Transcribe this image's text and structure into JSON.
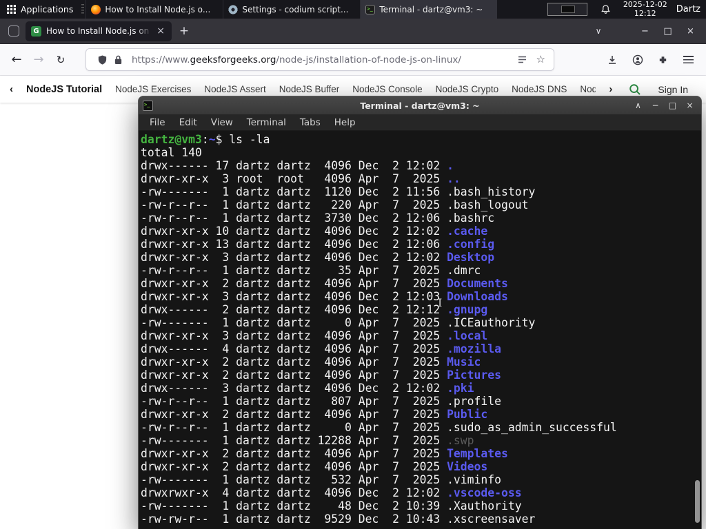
{
  "colors": {
    "panel_bg": "#17171c",
    "tab_bg": "#1d1c23",
    "toolbar_bg": "#f9f9fb",
    "gfg_green": "#2f8d46",
    "terminal_bg": "#151515",
    "terminal_text": "#f2f2f2",
    "terminal_dir_blue": "#5a5aef",
    "terminal_prompt_green": "#44b340",
    "terminal_dim_gray": "#5a5a5a"
  },
  "panel": {
    "applications_label": "Applications",
    "tasks": [
      {
        "label": "How to Install Node.js o...",
        "icon": "firefox"
      },
      {
        "label": "Settings - codium script...",
        "icon": "settings"
      },
      {
        "label": "Terminal - dartz@vm3: ~",
        "icon": "terminal"
      }
    ],
    "clock_date": "2025-12-02",
    "clock_time": "12:12",
    "user": "Dartz"
  },
  "browser": {
    "tab_title": "How to Install Node.js on",
    "url": {
      "scheme": "https://www.",
      "domain": "geeksforgeeks.org",
      "path": "/node-js/installation-of-node-js-on-linux/"
    },
    "nav_links": [
      "NodeJS Tutorial",
      "NodeJS Exercises",
      "NodeJS Assert",
      "NodeJS Buffer",
      "NodeJS Console",
      "NodeJS Crypto",
      "NodeJS DNS",
      "Node"
    ],
    "sign_in_label": "Sign In"
  },
  "terminal": {
    "title": "Terminal - dartz@vm3: ~",
    "menu": [
      "File",
      "Edit",
      "View",
      "Terminal",
      "Tabs",
      "Help"
    ],
    "prompt_user_host": "dartz@vm3",
    "prompt_colon": ":",
    "prompt_path": "~",
    "prompt_suffix": "$ ",
    "command": "ls -la",
    "total_line": "total 140",
    "listing": [
      {
        "pre": "drwx------ 17 dartz dartz  4096 Dec  2 12:02 ",
        "name": ".",
        "type": "dir"
      },
      {
        "pre": "drwxr-xr-x  3 root  root   4096 Apr  7  2025 ",
        "name": "..",
        "type": "dir"
      },
      {
        "pre": "-rw-------  1 dartz dartz  1120 Dec  2 11:56 ",
        "name": ".bash_history",
        "type": "file"
      },
      {
        "pre": "-rw-r--r--  1 dartz dartz   220 Apr  7  2025 ",
        "name": ".bash_logout",
        "type": "file"
      },
      {
        "pre": "-rw-r--r--  1 dartz dartz  3730 Dec  2 12:06 ",
        "name": ".bashrc",
        "type": "file"
      },
      {
        "pre": "drwxr-xr-x 10 dartz dartz  4096 Dec  2 12:02 ",
        "name": ".cache",
        "type": "dir"
      },
      {
        "pre": "drwxr-xr-x 13 dartz dartz  4096 Dec  2 12:06 ",
        "name": ".config",
        "type": "dir"
      },
      {
        "pre": "drwxr-xr-x  3 dartz dartz  4096 Dec  2 12:02 ",
        "name": "Desktop",
        "type": "dir"
      },
      {
        "pre": "-rw-r--r--  1 dartz dartz    35 Apr  7  2025 ",
        "name": ".dmrc",
        "type": "file"
      },
      {
        "pre": "drwxr-xr-x  2 dartz dartz  4096 Apr  7  2025 ",
        "name": "Documents",
        "type": "dir"
      },
      {
        "pre": "drwxr-xr-x  3 dartz dartz  4096 Dec  2 12:03 ",
        "name": "Downloads",
        "type": "dir"
      },
      {
        "pre": "drwx------  2 dartz dartz  4096 Dec  2 12:12 ",
        "name": ".gnupg",
        "type": "dir"
      },
      {
        "pre": "-rw-------  1 dartz dartz     0 Apr  7  2025 ",
        "name": ".ICEauthority",
        "type": "file"
      },
      {
        "pre": "drwxr-xr-x  3 dartz dartz  4096 Apr  7  2025 ",
        "name": ".local",
        "type": "dir"
      },
      {
        "pre": "drwx------  4 dartz dartz  4096 Apr  7  2025 ",
        "name": ".mozilla",
        "type": "dir"
      },
      {
        "pre": "drwxr-xr-x  2 dartz dartz  4096 Apr  7  2025 ",
        "name": "Music",
        "type": "dir"
      },
      {
        "pre": "drwxr-xr-x  2 dartz dartz  4096 Apr  7  2025 ",
        "name": "Pictures",
        "type": "dir"
      },
      {
        "pre": "drwx------  3 dartz dartz  4096 Dec  2 12:02 ",
        "name": ".pki",
        "type": "dir"
      },
      {
        "pre": "-rw-r--r--  1 dartz dartz   807 Apr  7  2025 ",
        "name": ".profile",
        "type": "file"
      },
      {
        "pre": "drwxr-xr-x  2 dartz dartz  4096 Apr  7  2025 ",
        "name": "Public",
        "type": "dir"
      },
      {
        "pre": "-rw-r--r--  1 dartz dartz     0 Apr  7  2025 ",
        "name": ".sudo_as_admin_successful",
        "type": "file"
      },
      {
        "pre": "-rw-------  1 dartz dartz 12288 Apr  7  2025 ",
        "name": ".swp",
        "type": "dim"
      },
      {
        "pre": "drwxr-xr-x  2 dartz dartz  4096 Apr  7  2025 ",
        "name": "Templates",
        "type": "dir"
      },
      {
        "pre": "drwxr-xr-x  2 dartz dartz  4096 Apr  7  2025 ",
        "name": "Videos",
        "type": "dir"
      },
      {
        "pre": "-rw-------  1 dartz dartz   532 Apr  7  2025 ",
        "name": ".viminfo",
        "type": "file"
      },
      {
        "pre": "drwxrwxr-x  4 dartz dartz  4096 Dec  2 12:02 ",
        "name": ".vscode-oss",
        "type": "dir"
      },
      {
        "pre": "-rw-------  1 dartz dartz    48 Dec  2 10:39 ",
        "name": ".Xauthority",
        "type": "file"
      },
      {
        "pre": "-rw-rw-r--  1 dartz dartz  9529 Dec  2 10:43 ",
        "name": ".xscreensaver",
        "type": "file"
      }
    ]
  }
}
